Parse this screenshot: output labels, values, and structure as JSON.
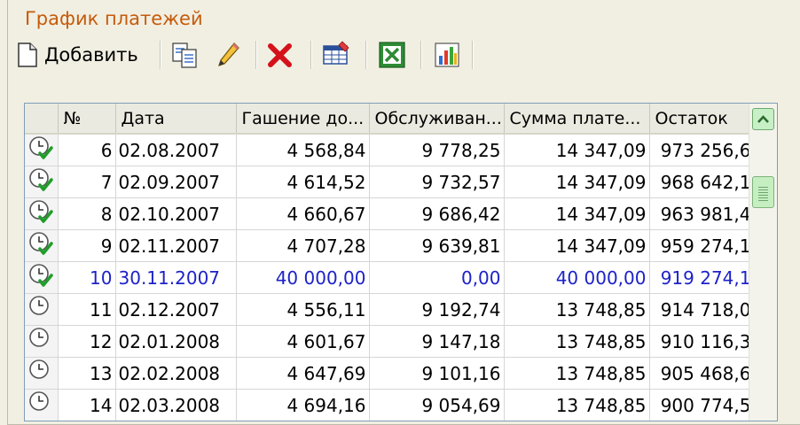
{
  "panel": {
    "title": "График платежей"
  },
  "toolbar": {
    "add_label": "Добавить",
    "icons": [
      "new-document-icon",
      "copy-icon",
      "pencil-icon",
      "delete-x-icon",
      "table-icon",
      "excel-icon",
      "chart-icon"
    ]
  },
  "grid": {
    "headers": [
      "№",
      "Дата",
      "Гашение до...",
      "Обслуживан...",
      "Сумма плате...",
      "Остаток"
    ],
    "rows": [
      {
        "num": "6",
        "date": "02.08.2007",
        "principal": "4 568,84",
        "service": "9 778,25",
        "payment": "14 347,09",
        "balance": "973 256,6",
        "status": "paid",
        "selected": false
      },
      {
        "num": "7",
        "date": "02.09.2007",
        "principal": "4 614,52",
        "service": "9 732,57",
        "payment": "14 347,09",
        "balance": "968 642,1",
        "status": "paid",
        "selected": false
      },
      {
        "num": "8",
        "date": "02.10.2007",
        "principal": "4 660,67",
        "service": "9 686,42",
        "payment": "14 347,09",
        "balance": "963 981,4",
        "status": "paid",
        "selected": false
      },
      {
        "num": "9",
        "date": "02.11.2007",
        "principal": "4 707,28",
        "service": "9 639,81",
        "payment": "14 347,09",
        "balance": "959 274,1",
        "status": "paid",
        "selected": false
      },
      {
        "num": "10",
        "date": "30.11.2007",
        "principal": "40 000,00",
        "service": "0,00",
        "payment": "40 000,00",
        "balance": "919 274,1",
        "status": "paid",
        "selected": true
      },
      {
        "num": "11",
        "date": "02.12.2007",
        "principal": "4 556,11",
        "service": "9 192,74",
        "payment": "13 748,85",
        "balance": "914 718,0",
        "status": "pending",
        "selected": false
      },
      {
        "num": "12",
        "date": "02.01.2008",
        "principal": "4 601,67",
        "service": "9 147,18",
        "payment": "13 748,85",
        "balance": "910 116,3",
        "status": "pending",
        "selected": false
      },
      {
        "num": "13",
        "date": "02.02.2008",
        "principal": "4 647,69",
        "service": "9 101,16",
        "payment": "13 748,85",
        "balance": "905 468,6",
        "status": "pending",
        "selected": false
      },
      {
        "num": "14",
        "date": "02.03.2008",
        "principal": "4 694,16",
        "service": "9 054,69",
        "payment": "13 748,85",
        "balance": "900 774,5",
        "status": "pending",
        "selected": false
      }
    ]
  },
  "colors": {
    "title": "#c65b0c",
    "selected_text": "#1d22c8",
    "grid_border": "#7f9db9"
  }
}
